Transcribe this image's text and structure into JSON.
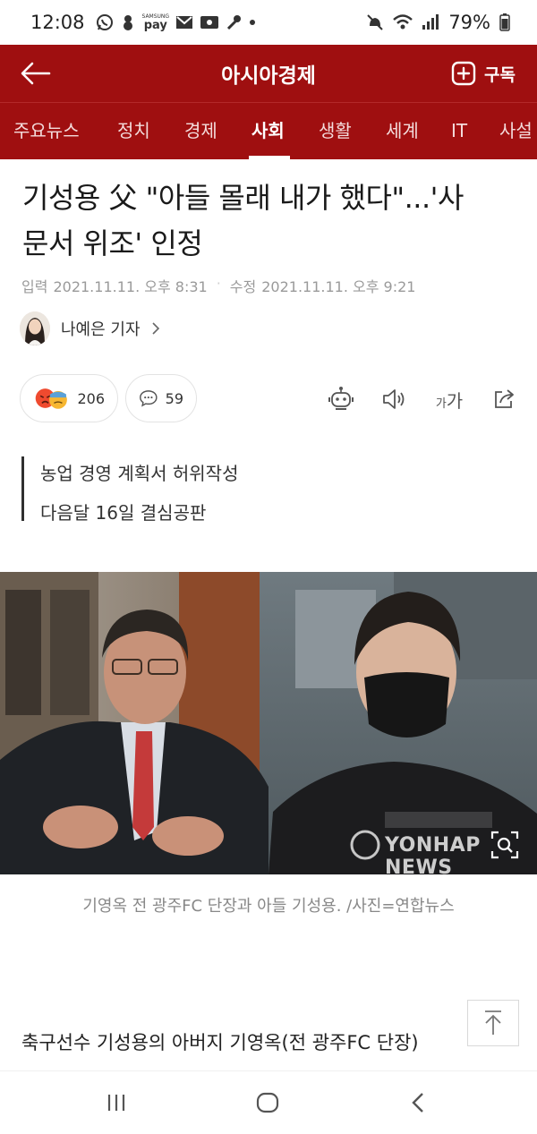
{
  "status_bar": {
    "time": "12:08",
    "battery": "79%",
    "icons": [
      "whatsapp-icon",
      "dollar-icon",
      "samsung-pay-icon",
      "mail-icon",
      "photo-icon",
      "mic-icon",
      "dot-icon",
      "mute-icon",
      "wifi-icon",
      "signal-icon",
      "battery-icon"
    ],
    "samsung_pay_top": "SAMSUNG",
    "samsung_pay_bottom": "pay"
  },
  "header": {
    "title": "아시아경제",
    "back_icon": "back-arrow-icon",
    "subscribe_label": "구독",
    "subscribe_icon": "plus-box-icon",
    "brand_color": "#9f0f10"
  },
  "categories": [
    {
      "label": "주요뉴스",
      "active": false
    },
    {
      "label": "정치",
      "active": false
    },
    {
      "label": "경제",
      "active": false
    },
    {
      "label": "사회",
      "active": true
    },
    {
      "label": "생활",
      "active": false
    },
    {
      "label": "세계",
      "active": false
    },
    {
      "label": "IT",
      "active": false
    },
    {
      "label": "사설",
      "active": false
    }
  ],
  "article": {
    "headline_line1": "기성용 父 \"아들 몰래 내가 했다\"...'사",
    "headline_line2": "문서 위조' 인정",
    "published_label": "입력",
    "published": "2021.11.11. 오후 8:31",
    "modified_label": "수정",
    "modified": "2021.11.11. 오후 9:21",
    "reporter": "나예은 기자",
    "reactions_count": "206",
    "comments_count": "59",
    "font_size_label_small": "가",
    "font_size_label_big": "가",
    "summary": [
      "농업 경영 계획서 허위작성",
      "다음달 16일 결심공판"
    ],
    "photo_watermark": "YONHAP NEWS",
    "caption": "기영옥 전 광주FC 단장과 아들 기성용. /사진=연합뉴스",
    "body_start": "축구선수 기성용의 아버지 기영옥(전 광주FC 단장)"
  }
}
